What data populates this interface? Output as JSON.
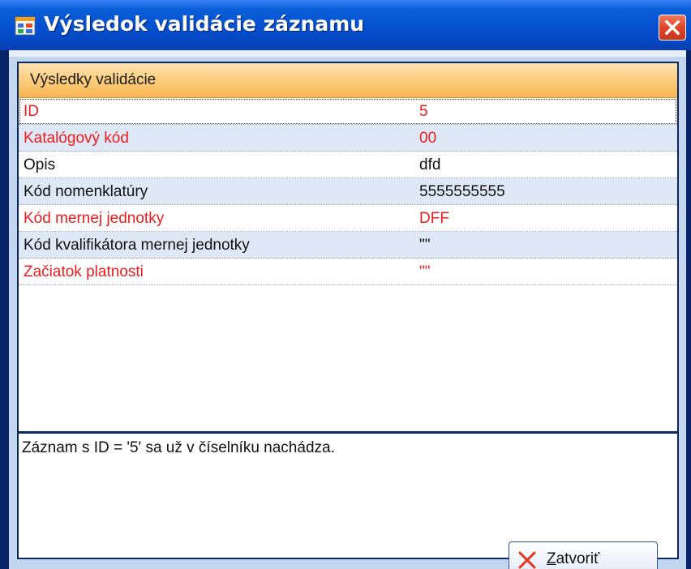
{
  "window": {
    "title": "Výsledok validácie záznamu",
    "icon": "app-window-icon",
    "close_icon": "close-icon"
  },
  "panel": {
    "header": "Výsledky validácie",
    "rows": [
      {
        "label": "ID",
        "value": "5",
        "status": "error"
      },
      {
        "label": "Katalógový kód",
        "value": "00",
        "status": "error"
      },
      {
        "label": "Opis",
        "value": "dfd",
        "status": "ok"
      },
      {
        "label": "Kód nomenklatúry",
        "value": "5555555555",
        "status": "ok"
      },
      {
        "label": "Kód mernej jednotky",
        "value": "DFF",
        "status": "error"
      },
      {
        "label": "Kód kvalifikátora mernej jednotky",
        "value": "\"\"",
        "status": "ok"
      },
      {
        "label": "Začiatok platnosti",
        "value": "\"\"",
        "status": "error"
      }
    ],
    "message": "Záznam s ID = '5' sa už v číselníku nachádza."
  },
  "buttons": {
    "close_label_accel": "Z",
    "close_label_rest": "atvoriť",
    "close_icon": "x-icon"
  },
  "colors": {
    "error_text": "#ee1c1c",
    "header_bg": "#fbcd7c",
    "alt_row": "#dfe8f6",
    "title_bar": "#0551d0"
  }
}
